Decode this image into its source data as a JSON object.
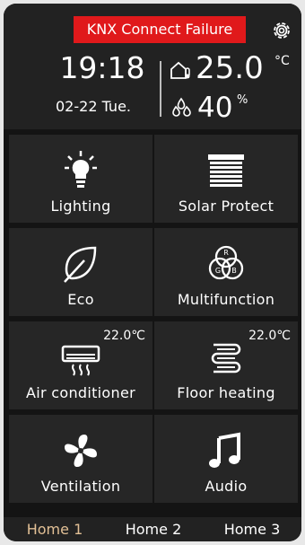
{
  "header": {
    "alert": "KNX Connect Failure",
    "time": "19:18",
    "date": "02-22 Tue.",
    "temperature": "25.0",
    "temperature_unit": "°C",
    "humidity": "40",
    "humidity_unit": "%"
  },
  "tiles": [
    {
      "label": "Lighting",
      "icon": "light-bulb-icon"
    },
    {
      "label": "Solar Protect",
      "icon": "blinds-icon"
    },
    {
      "label": "Eco",
      "icon": "leaf-icon"
    },
    {
      "label": "Multifunction",
      "icon": "rgb-circles-icon"
    },
    {
      "label": "Air conditioner",
      "icon": "air-conditioner-icon",
      "setpoint": "22.0℃"
    },
    {
      "label": "Floor heating",
      "icon": "floor-heating-icon",
      "setpoint": "22.0℃"
    },
    {
      "label": "Ventilation",
      "icon": "fan-icon"
    },
    {
      "label": "Audio",
      "icon": "music-note-icon"
    }
  ],
  "tabs": [
    {
      "label": "Home 1",
      "active": true
    },
    {
      "label": "Home 2",
      "active": false
    },
    {
      "label": "Home 3",
      "active": false
    }
  ],
  "colors": {
    "alert": "#e0191b",
    "active_tab": "#e2c096",
    "tile": "#262626"
  }
}
